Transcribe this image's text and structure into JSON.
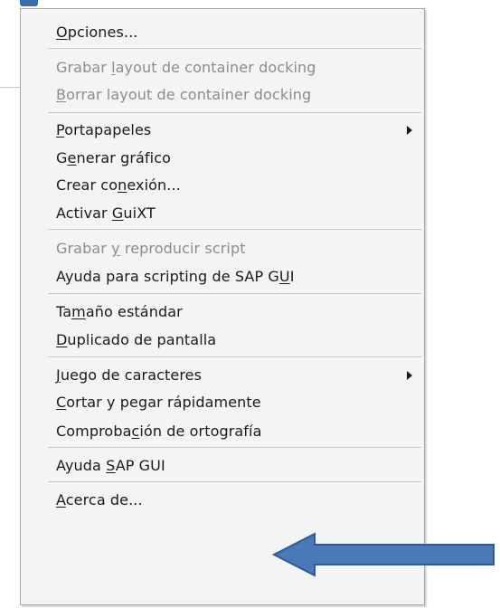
{
  "menu": {
    "items": [
      {
        "pre": "",
        "u": "O",
        "post": "pciones...",
        "disabled": false,
        "submenu": false
      },
      {
        "pre": "Grabar ",
        "u": "l",
        "post": "ayout de container docking",
        "disabled": true,
        "submenu": false
      },
      {
        "pre": "",
        "u": "B",
        "post": "orrar layout de container docking",
        "disabled": true,
        "submenu": false
      },
      {
        "pre": "",
        "u": "P",
        "post": "ortapapeles",
        "disabled": false,
        "submenu": true
      },
      {
        "pre": "G",
        "u": "e",
        "post": "nerar gráfico",
        "disabled": false,
        "submenu": false
      },
      {
        "pre": "Crear co",
        "u": "n",
        "post": "exión...",
        "disabled": false,
        "submenu": false
      },
      {
        "pre": "Activar ",
        "u": "G",
        "post": "uiXT",
        "disabled": false,
        "submenu": false
      },
      {
        "pre": "Grabar ",
        "u": "y",
        "post": " reproducir script",
        "disabled": true,
        "submenu": false
      },
      {
        "pre": "Ayuda para scripting de SAP G",
        "u": "U",
        "post": "I",
        "disabled": false,
        "submenu": false
      },
      {
        "pre": "Ta",
        "u": "m",
        "post": "año estándar",
        "disabled": false,
        "submenu": false
      },
      {
        "pre": "",
        "u": "D",
        "post": "uplicado de pantalla",
        "disabled": false,
        "submenu": false
      },
      {
        "pre": "",
        "u": "J",
        "post": "uego de caracteres",
        "disabled": false,
        "submenu": true
      },
      {
        "pre": "",
        "u": "C",
        "post": "ortar y pegar rápidamente",
        "disabled": false,
        "submenu": false
      },
      {
        "pre": "Comproba",
        "u": "c",
        "post": "ión de ortografía",
        "disabled": false,
        "submenu": false
      },
      {
        "pre": "Ayuda ",
        "u": "S",
        "post": "AP GUI",
        "disabled": false,
        "submenu": false
      },
      {
        "pre": "",
        "u": "A",
        "post": "cerca de...",
        "disabled": false,
        "submenu": false
      }
    ]
  },
  "colors": {
    "text": "#1a1a1a",
    "disabled_text": "#8c8c8c",
    "menu_bg": "#f4f4f4",
    "arrow_fill": "#4a78b8",
    "arrow_stroke": "#2f5a96"
  },
  "icons": {
    "submenu": "submenu-arrow-icon",
    "pointer": "pointer-arrow-icon"
  }
}
